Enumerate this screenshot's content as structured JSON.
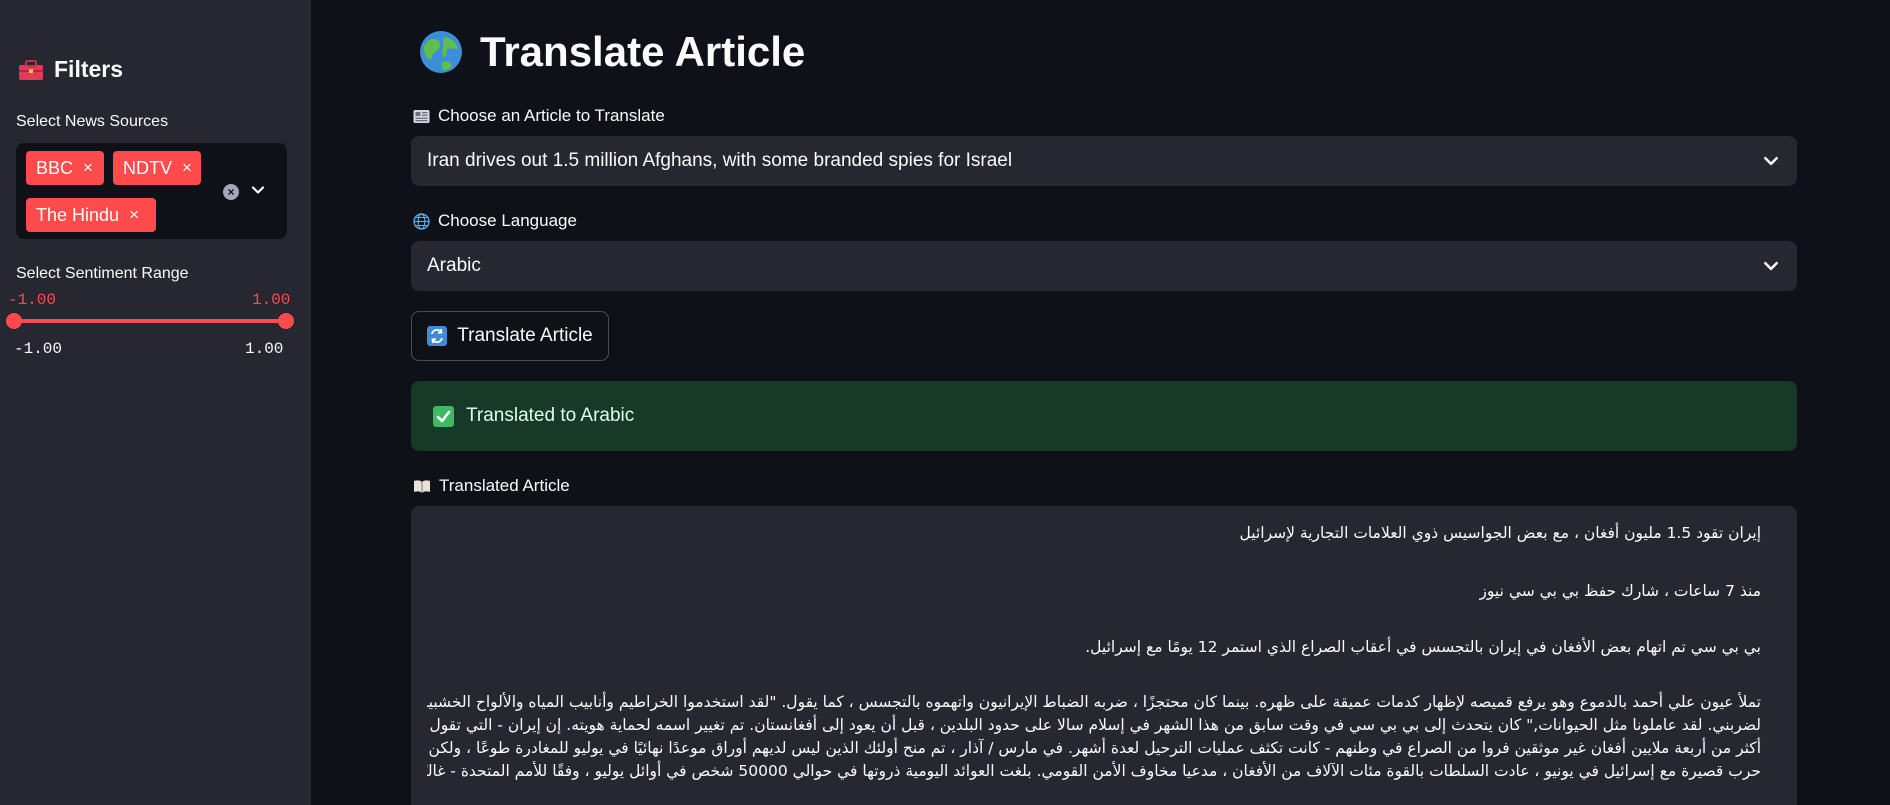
{
  "sidebar": {
    "title": "Filters",
    "news_sources_label": "Select News Sources",
    "selected_sources": [
      "BBC",
      "NDTV",
      "The Hindu"
    ],
    "chip_remove": "×",
    "sentiment_label": "Select Sentiment Range",
    "slider_min_value": "-1.00",
    "slider_max_value": "1.00",
    "range_min": "-1.00",
    "range_max": "1.00"
  },
  "main": {
    "title": "Translate Article",
    "article_label": "Choose an Article to Translate",
    "article_selected": "Iran drives out 1.5 million Afghans, with some branded spies for Israel",
    "language_label": "Choose Language",
    "language_selected": "Arabic",
    "translate_button": "Translate Article",
    "success_message": "Translated to Arabic",
    "translated_label": "Translated Article",
    "translated_text": [
      "إيران تقود 1.5 مليون أفغان ، مع بعض الجواسيس ذوي العلامات التجارية لإسرائيل",
      "منذ 7 ساعات ، شارك حفظ بي بي سي نيوز",
      "بي بي سي تم اتهام بعض الأفغان في إيران بالتجسس في أعقاب الصراع الذي استمر 12 يومًا مع إسرائيل.",
      "تملأ عيون علي أحمد بالدموع وهو يرفع قميصه لإظهار كدمات عميقة على ظهره. بينما كان محتجزًا ، ضربه الضباط الإيرانيون واتهموه بالتجسس ، كما يقول. \"لقد استخدموا الخراطيم وأنابيب المياه والألواح الخشبية",
      "لضربني. لقد عاملونا مثل الحيوانات,\" كان يتحدث إلى بي بي سي في وقت سابق من هذا الشهر في إسلام سالا على حدود البلدين ، قبل أن يعود إلى أفغانستان. تم تغيير اسمه لحماية هويته. إن إيران - التي تقول إنها تستضيف",
      "أكثر من أربعة ملايين أفغان غير موثقين فروا من الصراع في وطنهم - كانت تكثف عمليات الترحيل لعدة أشهر. في مارس / آذار ، تم منح أولئك الذين ليس لديهم أوراق موعدًا نهائيًا في يوليو للمغادرة طوعًا ، ولكن منذ",
      "حرب قصيرة مع إسرائيل في يونيو ، عادت السلطات بالقوة مئات الآلاف من الأفغان ، مدعيا مخاوف الأمن القومي. بلغت العوائد اليومية ذروتها في حوالي 50000 شخص في أوائل يوليو ، وفقًا للأمم المتحدة - غالبًا بعد"
    ]
  },
  "colors": {
    "accent": "#ff4b4b",
    "sidebar_bg": "#262730",
    "page_bg": "#0e1117",
    "success_bg": "#173928"
  },
  "icons": [
    "toolbox-icon",
    "globe-icon",
    "newspaper-icon",
    "globe-small-icon",
    "refresh-icon",
    "checkbox-icon",
    "book-icon",
    "chevron-down-icon",
    "clear-icon"
  ]
}
